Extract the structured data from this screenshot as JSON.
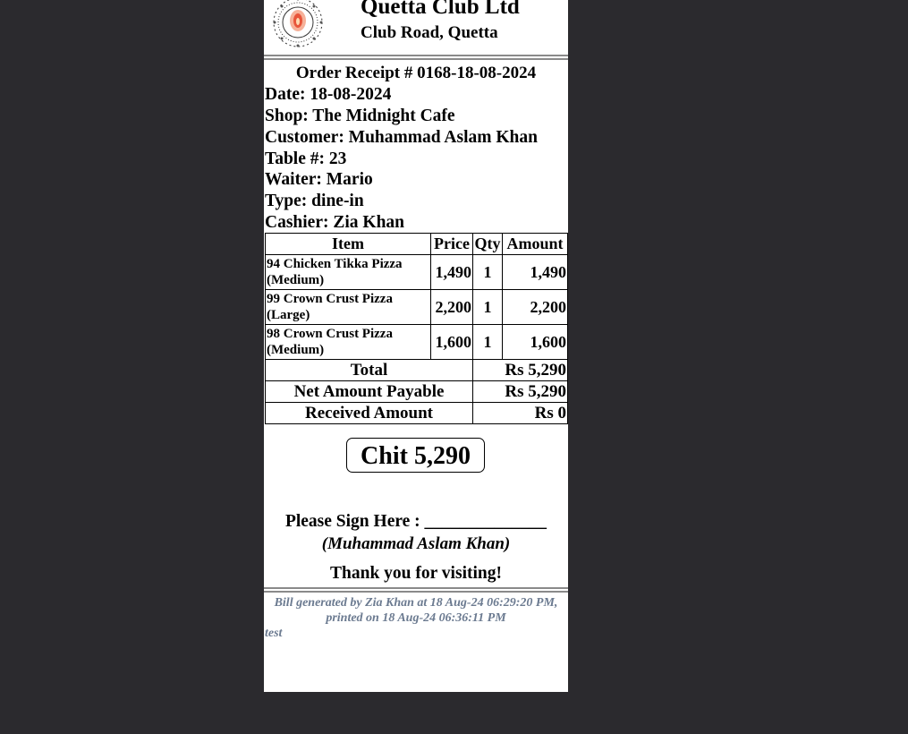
{
  "header": {
    "club_name": "Quetta Club Ltd",
    "club_address": "Club Road, Quetta"
  },
  "receipt": {
    "title": "Order Receipt # 0168-18-08-2024",
    "date": "Date: 18-08-2024",
    "shop": "Shop: The Midnight Cafe",
    "customer": "Customer: Muhammad Aslam Khan",
    "table": "Table #: 23",
    "waiter": "Waiter: Mario",
    "type": "Type: dine-in",
    "cashier": "Cashier: Zia Khan"
  },
  "items_table": {
    "headers": [
      "Item",
      "Price",
      "Qty",
      "Amount"
    ],
    "rows": [
      {
        "name": "94 Chicken Tikka Pizza (Medium)",
        "price": "1,490",
        "qty": "1",
        "amount": "1,490"
      },
      {
        "name": "99 Crown Crust Pizza (Large)",
        "price": "2,200",
        "qty": "1",
        "amount": "2,200"
      },
      {
        "name": "98 Crown Crust Pizza (Medium)",
        "price": "1,600",
        "qty": "1",
        "amount": "1,600"
      }
    ],
    "totals": [
      {
        "label": "Total",
        "value": "Rs 5,290"
      },
      {
        "label": "Net Amount Payable",
        "value": "Rs 5,290"
      },
      {
        "label": "Received Amount",
        "value": "Rs 0"
      }
    ]
  },
  "chit": "Chit 5,290",
  "signature": {
    "prompt": "Please Sign Here : ______________",
    "name": "(Muhammad Aslam Khan)"
  },
  "thanks": "Thank you for visiting!",
  "footer": {
    "generated": "Bill generated by Zia Khan at 18 Aug-24 06:29:20 PM, printed on 18 Aug-24 06:36:11 PM",
    "note": "test"
  },
  "colors": {
    "page_background": "#2b2a2e",
    "receipt_background": "#ffffff",
    "footer_text": "#6b7a90",
    "logo_accent": "#e8553a"
  }
}
